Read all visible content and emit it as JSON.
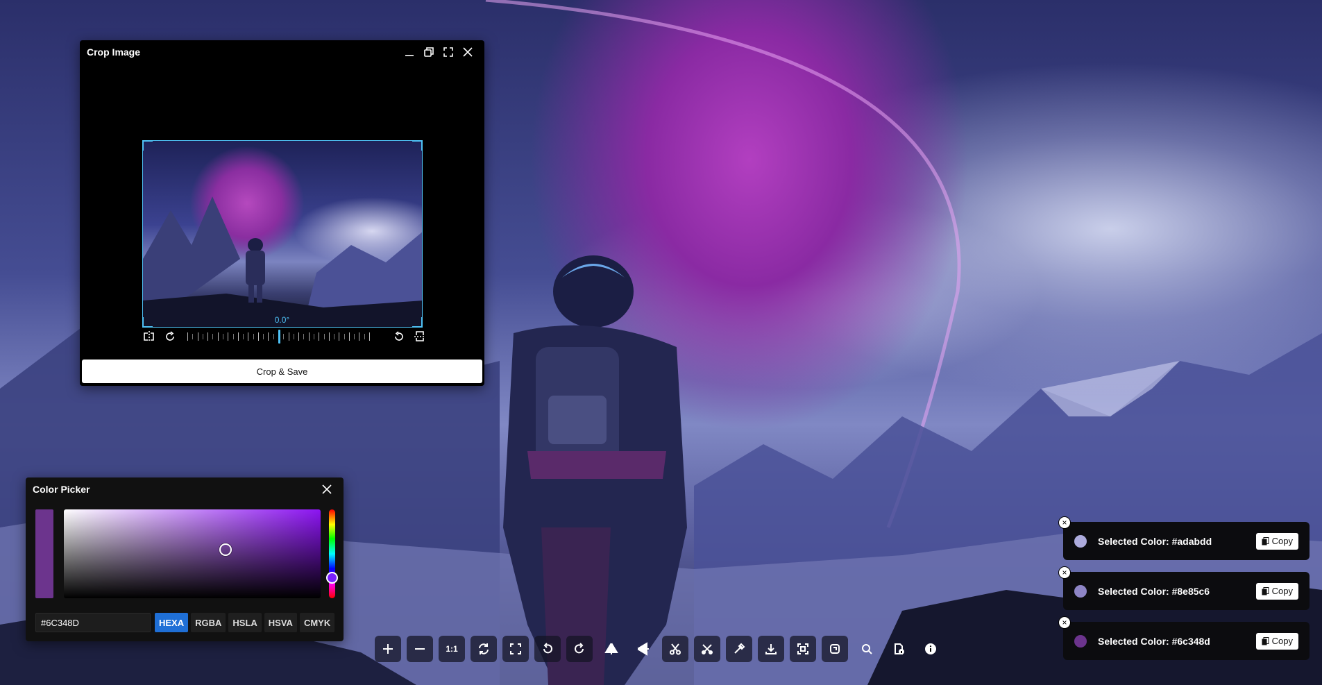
{
  "crop_window": {
    "title": "Crop Image",
    "angle": "0.0°",
    "save_label": "Crop & Save",
    "controls": [
      "minimize-icon",
      "restore-icon",
      "fullscreen-icon",
      "close-icon"
    ]
  },
  "color_picker": {
    "title": "Color Picker",
    "hex_value": "#6C348D",
    "current_color": "#6c348d",
    "hue_color": "#8c14f2",
    "formats": [
      "HEXA",
      "RGBA",
      "HSLA",
      "HSVA",
      "CMYK"
    ],
    "active_format": "HEXA",
    "saturation": 0.63,
    "value": 0.55
  },
  "toolbar": {
    "buttons": [
      "plus-icon",
      "minus-icon",
      "one-to-one-icon",
      "rotate-sync-icon",
      "fit-screen-icon",
      "rotate-left-icon",
      "rotate-right-icon",
      "flip-horizontal-icon",
      "flip-vertical-icon",
      "cut-icon",
      "clear-icon",
      "eyedropper-icon",
      "download-icon",
      "scan-icon",
      "copy-icon",
      "search-icon",
      "file-info-icon",
      "info-icon"
    ],
    "one_to_one_label": "1:1"
  },
  "toasts": [
    {
      "message": "Selected Color: #adabdd",
      "color": "#adabdd",
      "copy_label": "Copy",
      "close_label": "×"
    },
    {
      "message": "Selected Color: #8e85c6",
      "color": "#8e85c6",
      "copy_label": "Copy",
      "close_label": "×"
    },
    {
      "message": "Selected Color: #6c348d",
      "color": "#6c348d",
      "copy_label": "Copy",
      "close_label": "×"
    }
  ]
}
